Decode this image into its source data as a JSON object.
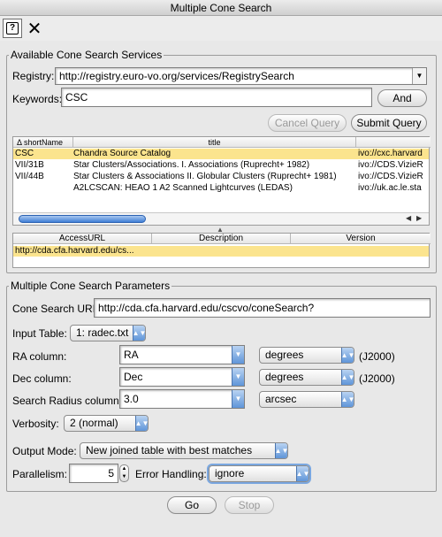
{
  "window": {
    "title": "Multiple Cone Search"
  },
  "toolbar": {
    "help_glyph": "?",
    "close_glyph": "✕"
  },
  "services": {
    "group_title": "Available Cone Search Services",
    "registry_label": "Registry:",
    "registry_value": "http://registry.euro-vo.org/services/RegistrySearch",
    "keywords_label": "Keywords:",
    "keywords_value": "CSC",
    "and_button": "And",
    "cancel_query_button": "Cancel Query",
    "submit_query_button": "Submit Query",
    "table": {
      "sort_indicator": "Δ",
      "columns": [
        "shortName",
        "title",
        ""
      ],
      "rows": [
        {
          "shortName": "CSC",
          "title": "Chandra Source Catalog",
          "ivo": "ivo://cxc.harvard",
          "selected": true
        },
        {
          "shortName": "VII/31B",
          "title": "Star Clusters/Associations. I. Associations (Ruprecht+ 1982)",
          "ivo": "ivo://CDS.VizieR",
          "selected": false
        },
        {
          "shortName": "VII/44B",
          "title": "Star Clusters & Associations II. Globular Clusters (Ruprecht+ 1981)",
          "ivo": "ivo://CDS.VizieR",
          "selected": false
        },
        {
          "shortName": "",
          "title": "A2LCSCAN: HEAO 1 A2 Scanned Lightcurves (LEDAS)",
          "ivo": "ivo://uk.ac.le.sta",
          "selected": false
        }
      ]
    },
    "capability_table": {
      "columns": [
        "AccessURL",
        "Description",
        "Version"
      ],
      "rows": [
        {
          "AccessURL": "http://cda.cfa.harvard.edu/cs...",
          "Description": "",
          "Version": "",
          "selected": true
        }
      ]
    }
  },
  "params": {
    "group_title": "Multiple Cone Search Parameters",
    "cone_url_label": "Cone Search URL:",
    "cone_url_value": "http://cda.cfa.harvard.edu/cscvo/coneSearch?",
    "input_table_label": "Input Table:",
    "input_table_value": "1: radec.txt",
    "ra_label": "RA column:",
    "ra_value": "RA",
    "ra_unit": "degrees",
    "ra_system": "(J2000)",
    "dec_label": "Dec column:",
    "dec_value": "Dec",
    "dec_unit": "degrees",
    "dec_system": "(J2000)",
    "radius_label": "Search Radius column:",
    "radius_value": "3.0",
    "radius_unit": "arcsec",
    "verbosity_label": "Verbosity:",
    "verbosity_value": "2 (normal)",
    "output_mode_label": "Output Mode:",
    "output_mode_value": "New joined table with best matches",
    "parallelism_label": "Parallelism:",
    "parallelism_value": "5",
    "error_handling_label": "Error Handling:",
    "error_handling_value": "ignore"
  },
  "footer": {
    "go_button": "Go",
    "stop_button": "Stop"
  }
}
